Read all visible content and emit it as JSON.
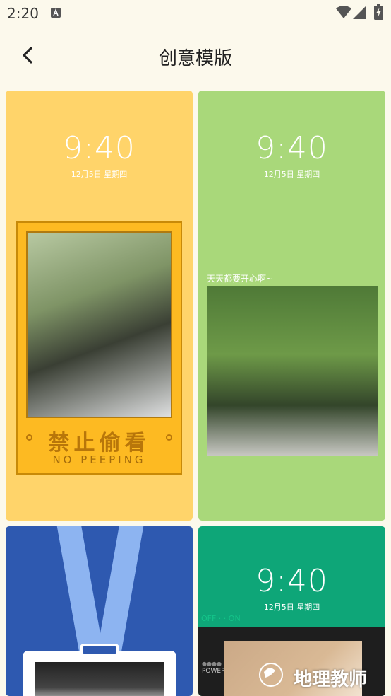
{
  "status_bar": {
    "time": "2:20"
  },
  "header": {
    "title": "创意模版"
  },
  "cards": [
    {
      "time": "9:40",
      "date": "12月5日  星期四",
      "sign_text": "禁止偷看",
      "sign_sub": "NO PEEPING",
      "bg_color": "#FFD46A"
    },
    {
      "time": "9:40",
      "date": "12月5日  星期四",
      "caption": "天天都要开心啊~",
      "bg_color": "#A9D87A"
    },
    {
      "bg_color": "#2E59B0"
    },
    {
      "time": "9:40",
      "date": "12月5日  星期四",
      "switch_labels": "OFF ·  · ON",
      "power_label": "POWER",
      "bg_color": "#0EA678"
    }
  ],
  "watermark": {
    "text": "地理教师"
  },
  "icons": {
    "back": "back-arrow-icon",
    "wifi": "wifi-icon",
    "signal": "signal-icon",
    "battery": "battery-charging-icon",
    "notification": "notification-a-icon"
  }
}
